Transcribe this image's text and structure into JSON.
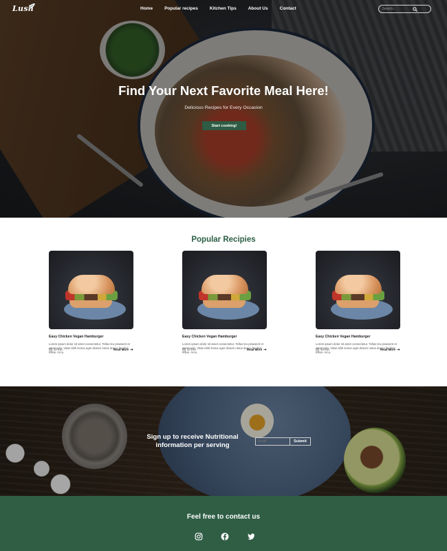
{
  "brand": {
    "logo_text": "Lush"
  },
  "nav": {
    "items": [
      {
        "label": "Home"
      },
      {
        "label": "Popular recipes"
      },
      {
        "label": "Kitchen Tips"
      },
      {
        "label": "About Us"
      },
      {
        "label": "Contact"
      }
    ],
    "search": {
      "placeholder": "Search...",
      "icon": "search-icon"
    }
  },
  "hero": {
    "title": "Find Your Next Favorite Meal Here!",
    "subtitle": "Delicious Recipes for Every Occasion",
    "button_label": "Start cooking!"
  },
  "popular": {
    "title": "Popular Recipies",
    "cards": [
      {
        "title": "Easy Chicken Vegan Hamburger",
        "description": "Lorem ipsum dolor sit amet consectetur. Tellus leo praesent et commodo. Vitae nibh lectus eget dictum netus donec facilisis tellus. Arcu.",
        "time": "20 min",
        "link": "Read More"
      },
      {
        "title": "Easy Chicken Vegan Hamburger",
        "description": "Lorem ipsum dolor sit amet consectetur. Tellus leo praesent et commodo. Vitae nibh lectus eget dictum netus donec facilisis tellus. Arcu.",
        "time": "20 min",
        "link": "Read More"
      },
      {
        "title": "Easy Chicken Vegan Hamburger",
        "description": "Lorem ipsum dolor sit amet consectetur. Tellus leo praesent et commodo. Vitae nibh lectus eget dictum netus donec facilisis tellus. Arcu.",
        "time": "25 min",
        "link": "Read More"
      }
    ]
  },
  "signup": {
    "text": "Sign up to receive Nutritional information per serving",
    "input_placeholder": "Email",
    "submit_label": "Submit"
  },
  "footer": {
    "title": "Feel free to contact us",
    "socials": [
      "instagram-icon",
      "facebook-icon",
      "twitter-icon"
    ]
  },
  "colors": {
    "brand_green": "#2f5e45",
    "title_green": "#2b5e45",
    "white": "#ffffff"
  }
}
